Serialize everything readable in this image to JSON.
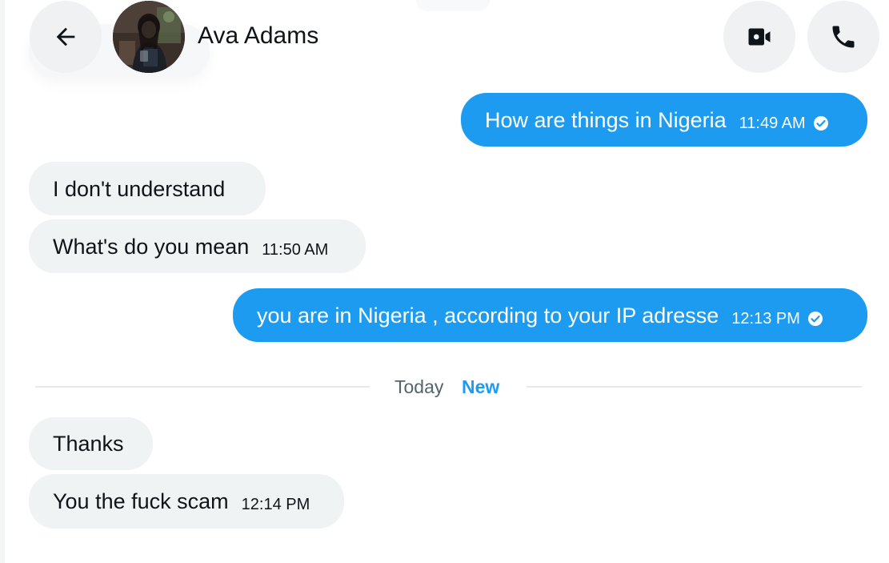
{
  "header": {
    "contact_name": "Ava Adams",
    "back_icon": "arrow-left-icon",
    "video_icon": "video-camera-icon",
    "call_icon": "phone-icon"
  },
  "messages": [
    {
      "direction": "sent",
      "text": "How are things in Nigeria",
      "time": "11:49 AM",
      "status_icon": "checkmark-circle-icon"
    },
    {
      "direction": "received",
      "text": "I don't understand",
      "time": ""
    },
    {
      "direction": "received",
      "text": "What's do you mean",
      "time": "11:50 AM"
    },
    {
      "direction": "sent",
      "text": "you are in Nigeria , according to your IP adresse",
      "time": "12:13 PM",
      "status_icon": "checkmark-circle-icon"
    },
    {
      "direction": "received",
      "text": "Thanks",
      "time": ""
    },
    {
      "direction": "received",
      "text": "You the fuck scam",
      "time": "12:14 PM"
    }
  ],
  "divider": {
    "label": "Today",
    "badge": "New"
  },
  "colors": {
    "accent": "#1d9bf0",
    "received_bubble": "#eff3f4",
    "button_bg": "#eff1f2",
    "muted_text": "#536471",
    "primary_text": "#0f1419"
  }
}
